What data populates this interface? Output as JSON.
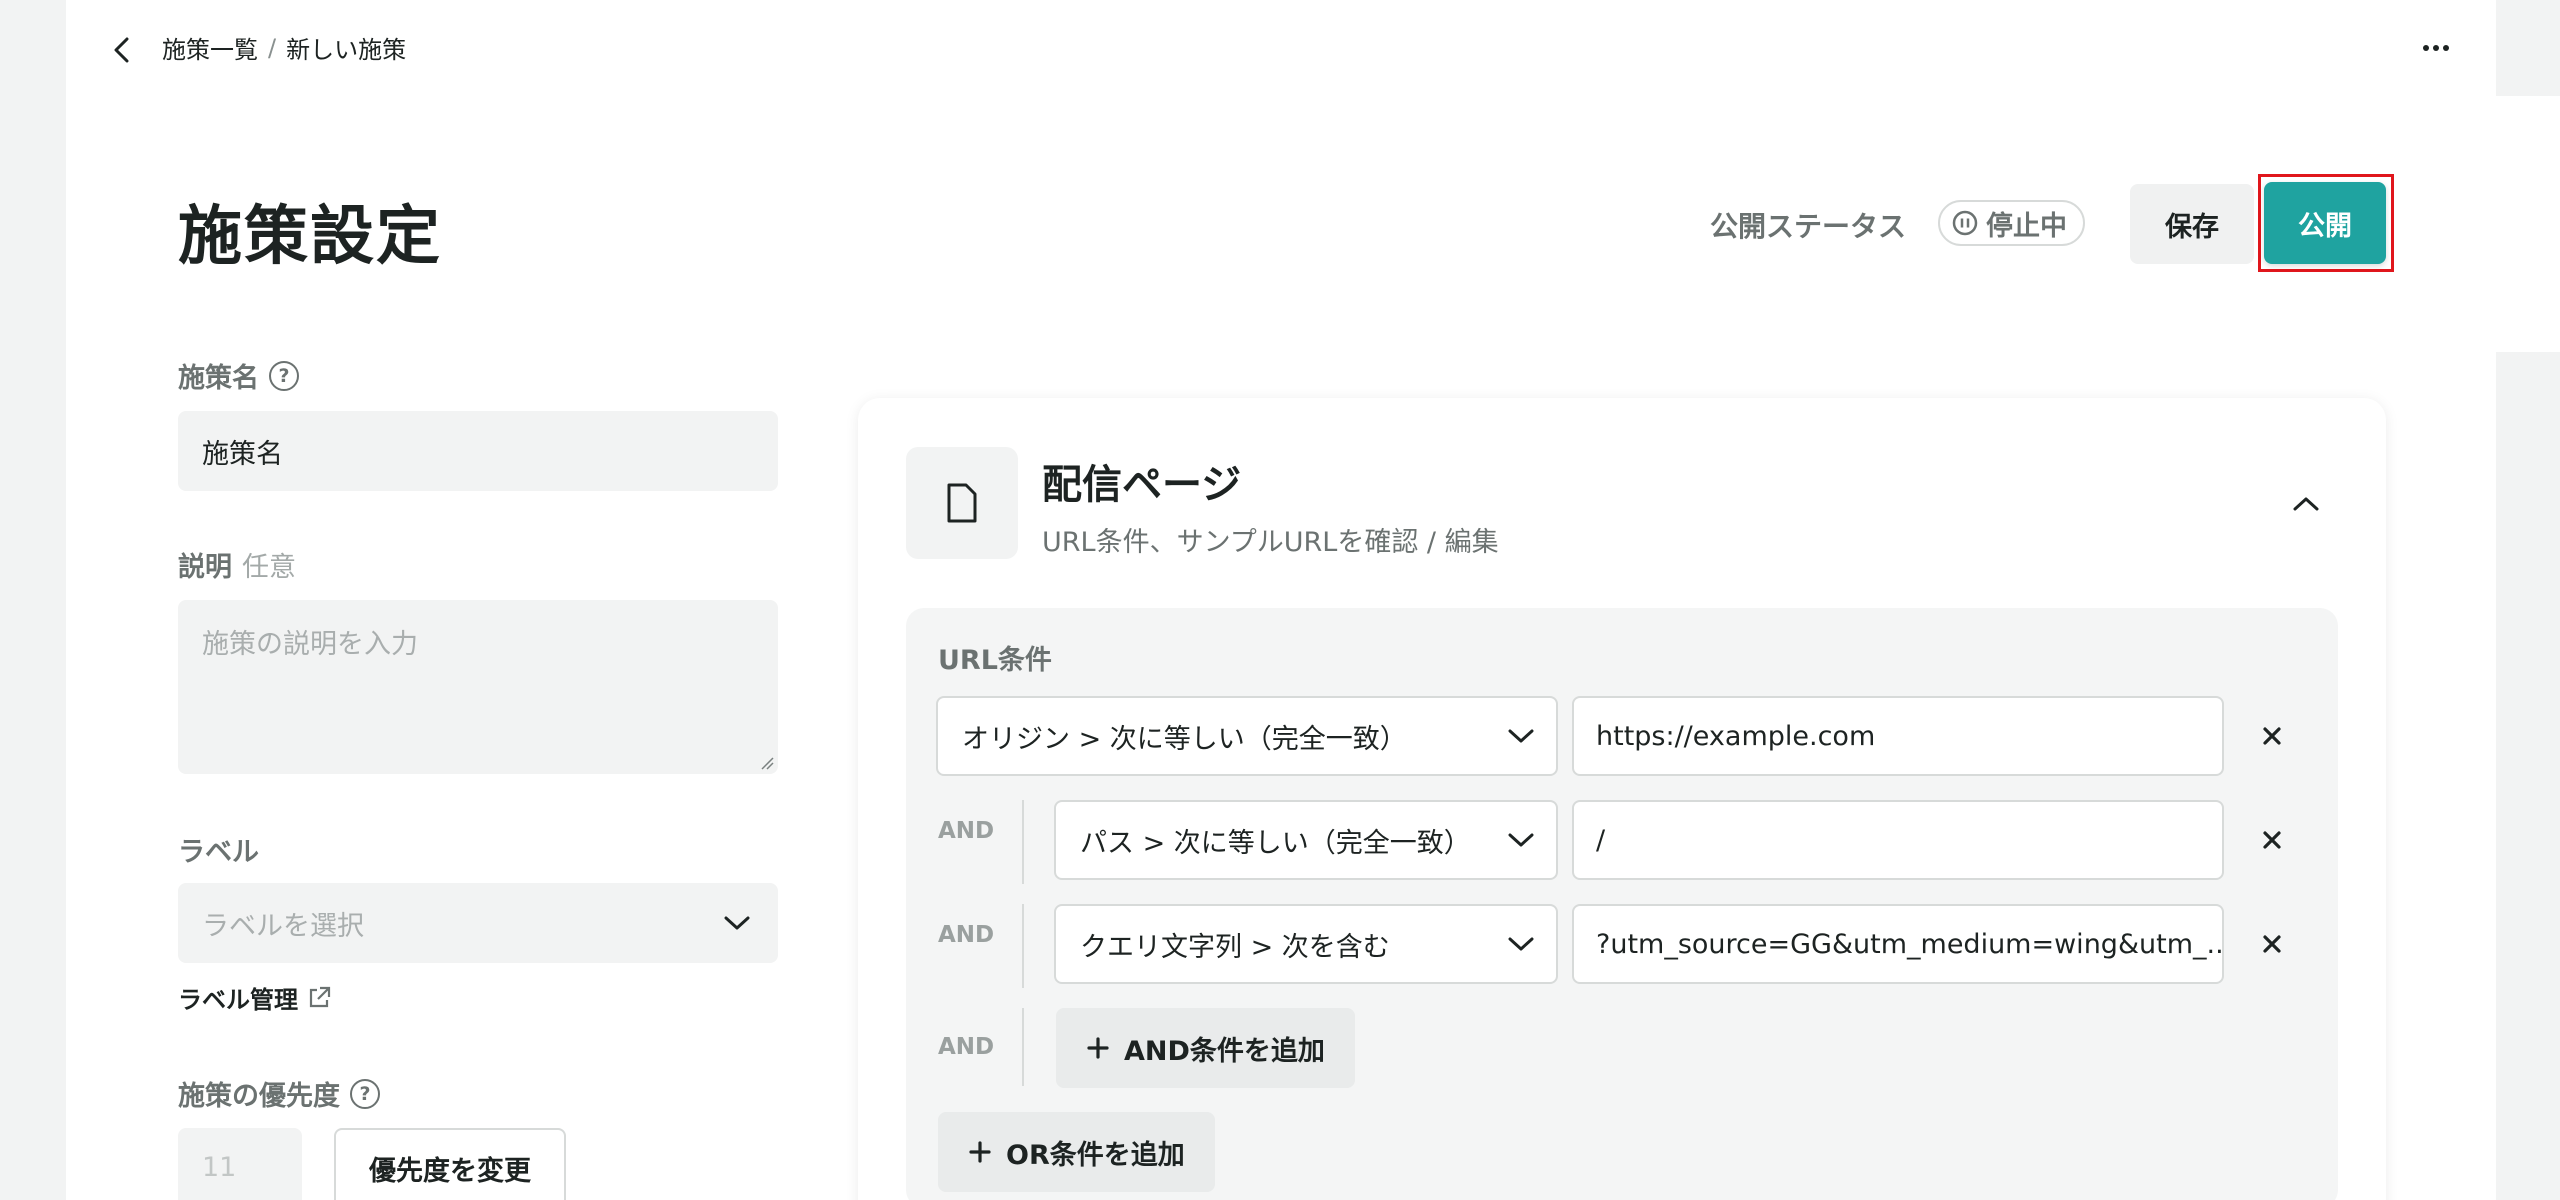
{
  "breadcrumb": {
    "parent": "施策一覧",
    "separator": "/",
    "current": "新しい施策"
  },
  "header": {
    "title": "施策設定",
    "status_label": "公開ステータス",
    "status_value": "停止中",
    "save_label": "保存",
    "publish_label": "公開"
  },
  "form": {
    "name_label": "施策名",
    "name_value": "施策名",
    "desc_label": "説明",
    "desc_optional": "任意",
    "desc_placeholder": "施策の説明を入力",
    "label_label": "ラベル",
    "label_placeholder": "ラベルを選択",
    "label_manage": "ラベル管理",
    "priority_label": "施策の優先度",
    "priority_value": "11",
    "priority_button": "優先度を変更"
  },
  "card": {
    "title": "配信ページ",
    "subtitle": "URL条件、サンプルURLを確認 / 編集",
    "conditions_title": "URL条件",
    "conditions": [
      {
        "connector": "",
        "operator": "オリジン > 次に等しい（完全一致）",
        "value": "https://example.com"
      },
      {
        "connector": "AND",
        "operator": "パス > 次に等しい（完全一致）",
        "value": "/"
      },
      {
        "connector": "AND",
        "operator": "クエリ文字列 > 次を含む",
        "value": "?utm_source=GG&utm_medium=wing&utm_..."
      }
    ],
    "add_and_connector": "AND",
    "add_and_label": "AND条件を追加",
    "add_or_label": "OR条件を追加"
  },
  "colors": {
    "accent": "#1fa3a0",
    "highlight_outline": "#e0161c",
    "background": "#f2f3f3"
  },
  "icons": [
    "back-arrow-icon",
    "more-icon",
    "pause-icon",
    "help-icon",
    "chevron-down-icon",
    "external-link-icon",
    "document-icon",
    "chevron-up-icon",
    "close-icon",
    "plus-icon"
  ]
}
